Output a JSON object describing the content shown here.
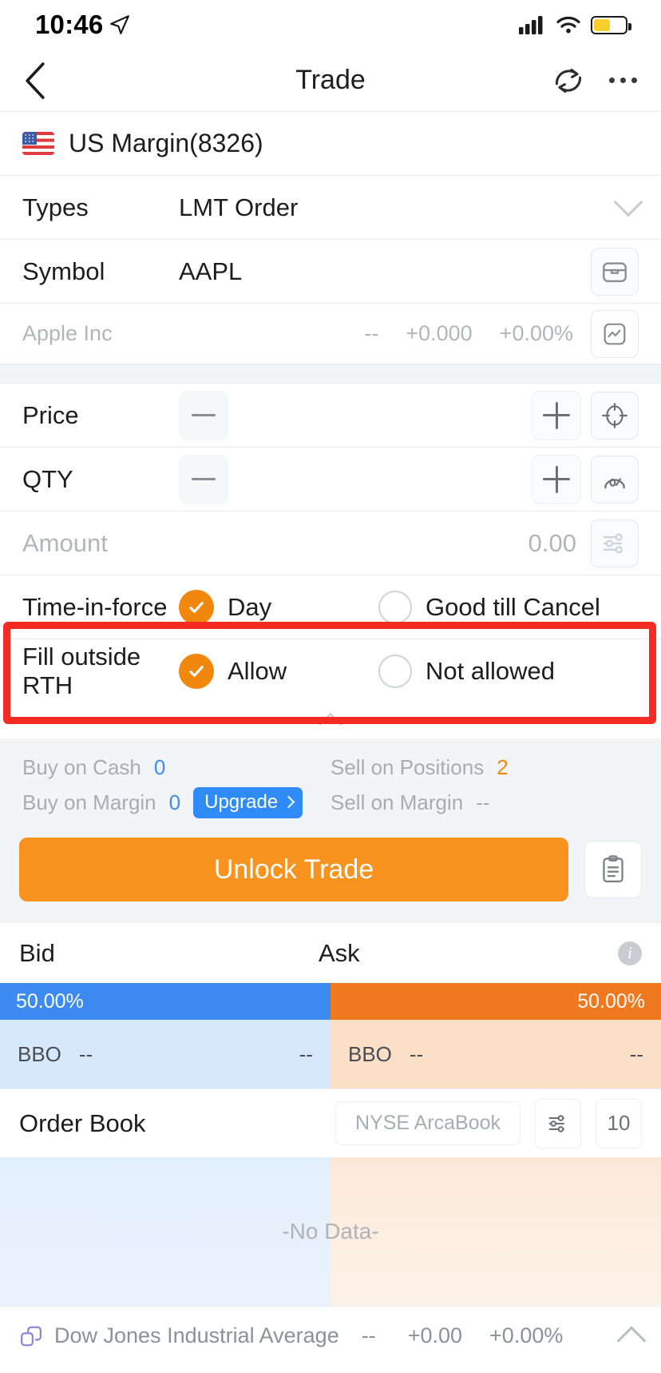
{
  "status_bar": {
    "time": "10:46",
    "location_icon": "location-arrow-icon",
    "signal_icon": "cellular-signal-icon",
    "wifi_icon": "wifi-icon",
    "battery_icon": "battery-low-power-icon"
  },
  "nav": {
    "back_icon": "chevron-left-icon",
    "title": "Trade",
    "refresh_icon": "refresh-icon",
    "more_icon": "more-options-icon"
  },
  "account": {
    "flag_icon": "us-flag-icon",
    "name": "US Margin(8326)"
  },
  "form": {
    "types_label": "Types",
    "types_value": "LMT Order",
    "types_chevron_icon": "chevron-down-icon",
    "symbol_label": "Symbol",
    "symbol_value": "AAPL",
    "symbol_button_icon": "portfolio-icon",
    "quote_name": "Apple Inc",
    "quote_last": "--",
    "quote_change": "+0.000",
    "quote_change_pct": "+0.00%",
    "quote_chart_icon": "line-chart-icon",
    "price_label": "Price",
    "price_value": "",
    "price_minus_icon": "minus-icon",
    "price_plus_icon": "plus-icon",
    "price_tool_icon": "target-price-icon",
    "qty_label": "QTY",
    "qty_value": "",
    "qty_minus_icon": "minus-icon",
    "qty_plus_icon": "plus-icon",
    "qty_tool_icon": "gauge-icon",
    "amount_label": "Amount",
    "amount_value": "0.00",
    "amount_tool_icon": "sliders-icon"
  },
  "time_in_force": {
    "label": "Time-in-force",
    "options": [
      {
        "label": "Day",
        "selected": true
      },
      {
        "label": "Good till Cancel",
        "selected": false
      }
    ]
  },
  "fill_outside_rth": {
    "label": "Fill outside RTH",
    "options": [
      {
        "label": "Allow",
        "selected": true
      },
      {
        "label": "Not allowed",
        "selected": false
      }
    ],
    "collapse_icon": "chevron-up-icon",
    "highlight_color": "#f42b23"
  },
  "buying_power": {
    "buy_on_cash_label": "Buy on Cash",
    "buy_on_cash_value": "0",
    "sell_on_positions_label": "Sell on Positions",
    "sell_on_positions_value": "2",
    "buy_on_margin_label": "Buy on Margin",
    "buy_on_margin_value": "0",
    "upgrade_label": "Upgrade",
    "upgrade_chevron_icon": "chevron-right-icon",
    "sell_on_margin_label": "Sell on Margin",
    "sell_on_margin_value": "--"
  },
  "action": {
    "unlock_label": "Unlock Trade",
    "unlock_color": "#f7931e",
    "orders_icon": "clipboard-orders-icon"
  },
  "quote_depth": {
    "bid_header": "Bid",
    "ask_header": "Ask",
    "info_icon": "info-icon",
    "bid_pct": "50.00%",
    "ask_pct": "50.00%",
    "bid_color": "#3d8bf2",
    "ask_color": "#f0781e",
    "bid_bbo_label": "BBO",
    "bid_bbo_price": "--",
    "bid_bbo_size": "--",
    "ask_bbo_label": "BBO",
    "ask_bbo_price": "--",
    "ask_bbo_size": "--"
  },
  "order_book": {
    "title": "Order Book",
    "source": "NYSE ArcaBook",
    "filter_icon": "sliders-icon",
    "depth_value": "10",
    "empty_text": "-No Data-"
  },
  "ticker": {
    "link_icon": "link-icon",
    "name": "Dow Jones Industrial Average",
    "last": "--",
    "change": "+0.00",
    "change_pct": "+0.00%",
    "collapse_icon": "chevron-up-icon"
  }
}
